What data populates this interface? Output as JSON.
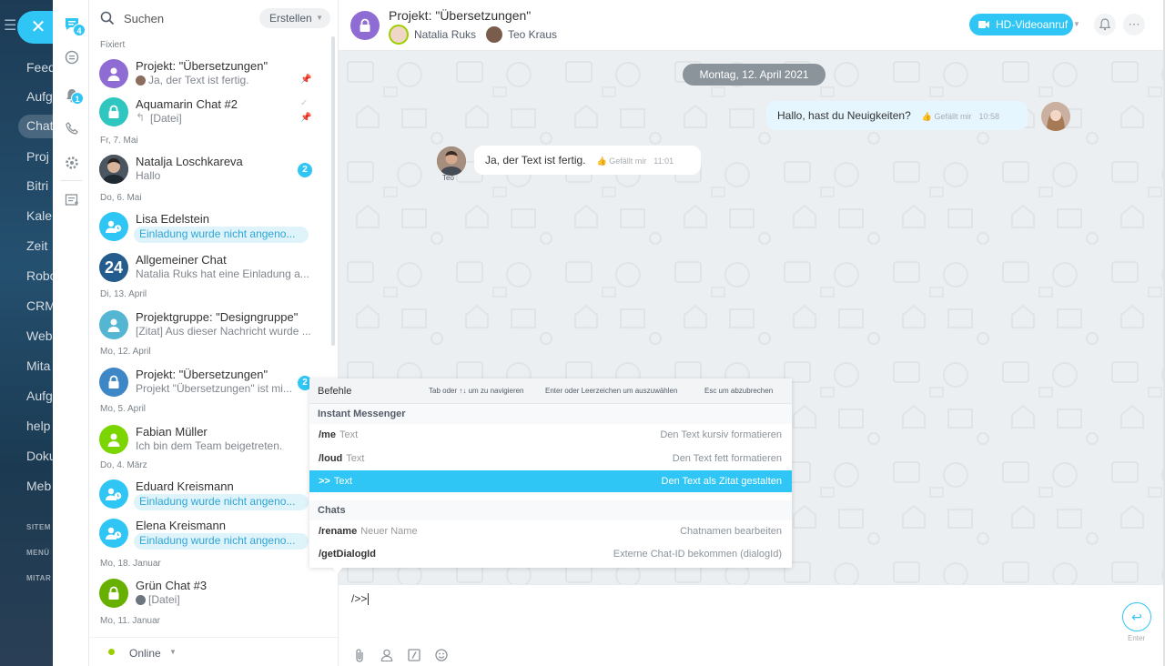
{
  "bg_nav": {
    "items": [
      "Feed",
      "Aufg",
      "Chat",
      "Proj",
      "Bitri",
      "Kale",
      "Zeit",
      "Robo",
      "CRM",
      "Web",
      "Mita",
      "Aufg",
      "help",
      "Doku",
      "Meb"
    ],
    "small_labels": [
      "SITEM",
      "MENÜ",
      "MITAR"
    ]
  },
  "iconbar": {
    "chat_badge": "4",
    "notify_badge": "1"
  },
  "search": {
    "placeholder": "Suchen",
    "create_label": "Erstellen"
  },
  "sections": [
    "Fixiert",
    "Fr, 7. Mai",
    "Do, 6. Mai",
    "Di, 13. April",
    "Mo, 12. April",
    "Mo, 5. April",
    "Do, 4. März",
    "Mo, 18. Januar",
    "Mo, 11. Januar"
  ],
  "chats": [
    {
      "name": "Projekt: \"Übersetzungen\"",
      "msg": "Ja, der Text ist fertig."
    },
    {
      "name": "Aquamarin Chat #2",
      "msg": "[Datei]"
    },
    {
      "name": "Natalja Loschkareva",
      "msg": "Hallo",
      "badge": "2"
    },
    {
      "name": "Lisa Edelstein",
      "msg": "Einladung wurde nicht angeno..."
    },
    {
      "name": "Allgemeiner Chat",
      "msg": "Natalia Ruks hat eine Einladung a...",
      "avatar_text": "24"
    },
    {
      "name": "Projektgruppe: \"Designgruppe\"",
      "msg": "[Zitat] Aus dieser Nachricht wurde ..."
    },
    {
      "name": "Projekt: \"Übersetzungen\"",
      "msg": "Projekt \"Übersetzungen\" ist mi...",
      "badge": "2"
    },
    {
      "name": "Fabian Müller",
      "msg": "Ich bin dem Team beigetreten."
    },
    {
      "name": "Eduard Kreismann",
      "msg": "Einladung wurde nicht angeno..."
    },
    {
      "name": "Elena Kreismann",
      "msg": "Einladung wurde nicht angeno..."
    },
    {
      "name": "Grün Chat #3",
      "msg": "[Datei]"
    }
  ],
  "status": {
    "label": "Online"
  },
  "header": {
    "title": "Projekt: \"Übersetzungen\"",
    "member1": "Natalia Ruks",
    "member2": "Teo Kraus",
    "video_label": "HD-Videoanruf"
  },
  "date_separator": "Montag, 12. April 2021",
  "messages": [
    {
      "text": "Hallo, hast du Neuigkeiten?",
      "like": "Gefällt mir",
      "time": "10:58"
    },
    {
      "text": "Ja, der Text ist fertig.",
      "like": "Gefällt mir",
      "time": "11:01",
      "author_label": "Teo"
    }
  ],
  "commands_popup": {
    "title": "Befehle",
    "hint_nav": "Tab oder ↑↓ um zu navigieren",
    "hint_select": "Enter oder Leerzeichen um auszuwählen",
    "hint_esc": "Esc um abzubrechen",
    "group1": "Instant Messenger",
    "group2": "Chats",
    "rows": [
      {
        "cmd": "/me",
        "arg": "Text",
        "desc": "Den Text kursiv formatieren"
      },
      {
        "cmd": "/loud",
        "arg": "Text",
        "desc": "Den Text fett formatieren"
      },
      {
        "cmd": ">>",
        "arg": "Text",
        "desc": "Den Text als Zitat gestalten"
      },
      {
        "cmd": "/rename",
        "arg": "Neuer Name",
        "desc": "Chatnamen bearbeiten"
      },
      {
        "cmd": "/getDialogId",
        "arg": "",
        "desc": "Externe Chat-ID bekommen (dialogId)"
      }
    ]
  },
  "input": {
    "value": "/>>",
    "enter_label": "Enter"
  },
  "colors": {
    "accent": "#2fc6f6",
    "purple": "#8e6cd4",
    "teal": "#2fc6c0",
    "green": "#9dcf00"
  }
}
